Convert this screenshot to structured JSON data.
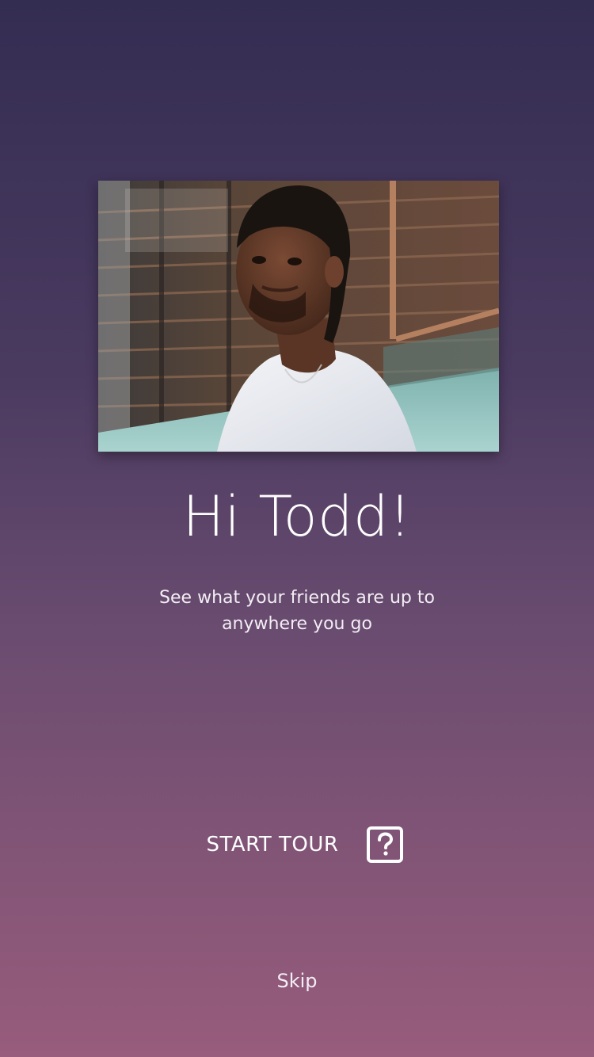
{
  "profile": {
    "photo_alt": "Profile photo"
  },
  "greeting": {
    "text": "Hi Todd!"
  },
  "subtitle": {
    "line1": "See what your friends are up to",
    "line2": "anywhere you go"
  },
  "tour": {
    "label": "START TOUR",
    "icon": "question-mark-box-icon"
  },
  "skip": {
    "label": "Skip"
  },
  "colors": {
    "gradient_top": "#342d52",
    "gradient_bottom": "#985c7c",
    "text": "#ffffff"
  }
}
